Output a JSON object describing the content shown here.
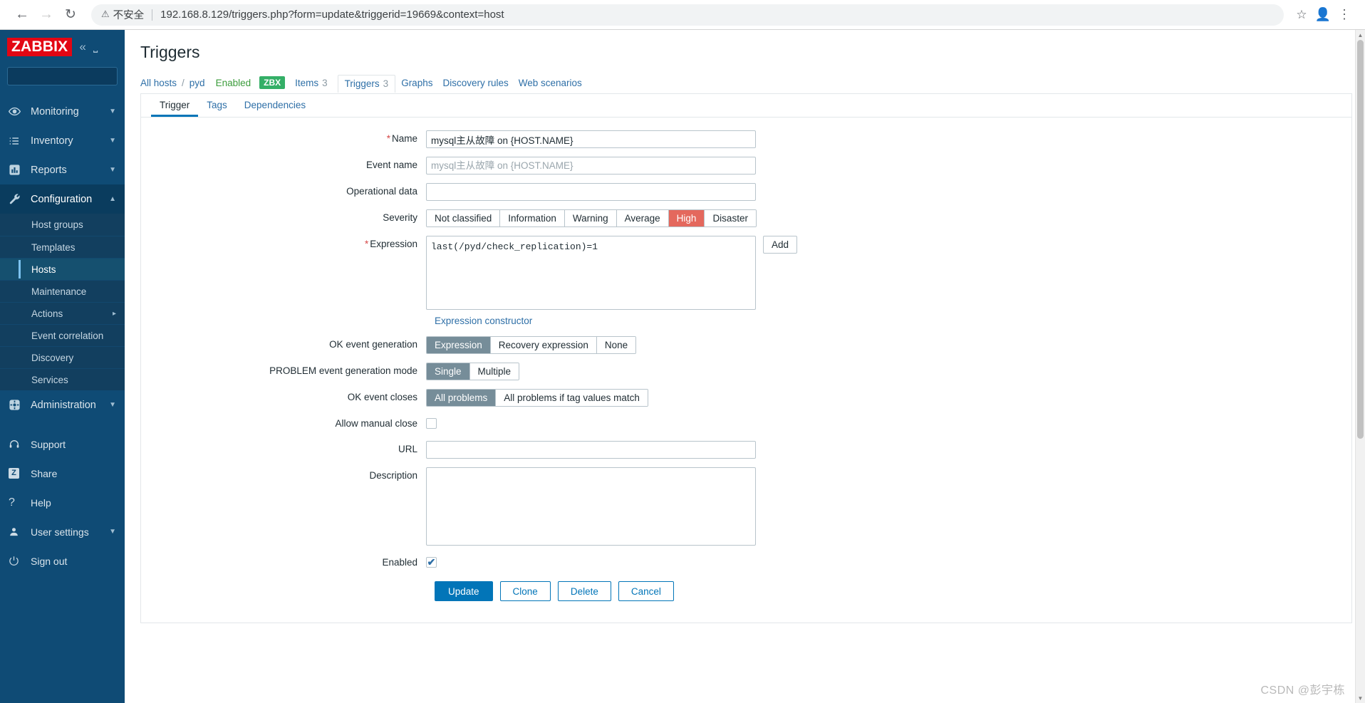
{
  "browser": {
    "back_icon": "back-arrow-icon",
    "forward_icon": "forward-arrow-icon",
    "reload_icon": "reload-icon",
    "warning_icon": "warning-triangle-icon",
    "security_label": "不安全",
    "url": "192.168.8.129/triggers.php?form=update&triggerid=19669&context=host",
    "star_icon": "bookmark-star-icon",
    "profile_icon": "profile-avatar-icon",
    "menu_icon": "kebab-menu-icon"
  },
  "sidebar": {
    "logo": "ZABBIX",
    "collapse_icon": "collapse-chevrons-icon",
    "hide_icon": "hide-sidebar-icon",
    "search": {
      "value": "",
      "placeholder": ""
    },
    "search_icon": "search-icon",
    "items": [
      {
        "label": "Monitoring",
        "icon": "eye-icon",
        "chevron": "⌄"
      },
      {
        "label": "Inventory",
        "icon": "list-icon",
        "chevron": "⌄"
      },
      {
        "label": "Reports",
        "icon": "bar-chart-icon",
        "chevron": "⌄"
      },
      {
        "label": "Configuration",
        "icon": "wrench-icon",
        "chevron": "⌃"
      }
    ],
    "submenu": [
      {
        "label": "Host groups"
      },
      {
        "label": "Templates"
      },
      {
        "label": "Hosts"
      },
      {
        "label": "Maintenance"
      },
      {
        "label": "Actions"
      },
      {
        "label": "Event correlation"
      },
      {
        "label": "Discovery"
      },
      {
        "label": "Services"
      }
    ],
    "administration": {
      "label": "Administration",
      "icon": "gear-icon",
      "chevron": "⌄"
    },
    "footer": [
      {
        "label": "Support",
        "icon": "headset-icon"
      },
      {
        "label": "Share",
        "icon": "zabbix-z-icon"
      },
      {
        "label": "Help",
        "icon": "question-mark-icon"
      },
      {
        "label": "User settings",
        "icon": "user-icon",
        "chevron": "⌄"
      },
      {
        "label": "Sign out",
        "icon": "power-icon"
      }
    ]
  },
  "header": {
    "title": "Triggers"
  },
  "breadcrumb": {
    "all_hosts": "All hosts",
    "separator": "/",
    "host": "pyd",
    "status": "Enabled",
    "agent_tag": "ZBX",
    "tabs": [
      {
        "label": "Items",
        "count": "3",
        "current": false
      },
      {
        "label": "Triggers",
        "count": "3",
        "current": true
      },
      {
        "label": "Graphs",
        "count": "",
        "current": false
      },
      {
        "label": "Discovery rules",
        "count": "",
        "current": false
      },
      {
        "label": "Web scenarios",
        "count": "",
        "current": false
      }
    ]
  },
  "form_tabs": [
    {
      "label": "Trigger",
      "active": true
    },
    {
      "label": "Tags",
      "active": false
    },
    {
      "label": "Dependencies",
      "active": false
    }
  ],
  "form": {
    "name": {
      "label": "Name",
      "required": true,
      "value": "mysql主从故障 on {HOST.NAME}",
      "placeholder": ""
    },
    "event_name": {
      "label": "Event name",
      "required": false,
      "value": "",
      "placeholder": "mysql主从故障 on {HOST.NAME}"
    },
    "operational_data": {
      "label": "Operational data",
      "required": false,
      "value": "",
      "placeholder": ""
    },
    "severity": {
      "label": "Severity",
      "options": [
        "Not classified",
        "Information",
        "Warning",
        "Average",
        "High",
        "Disaster"
      ],
      "selected": "High",
      "selected_color": "#e4685d"
    },
    "expression": {
      "label": "Expression",
      "required": true,
      "value": "last(/pyd/check_replication)=1",
      "add_button": "Add",
      "constructor_link": "Expression constructor"
    },
    "ok_event_generation": {
      "label": "OK event generation",
      "options": [
        "Expression",
        "Recovery expression",
        "None"
      ],
      "selected": "Expression"
    },
    "problem_event_generation_mode": {
      "label": "PROBLEM event generation mode",
      "options": [
        "Single",
        "Multiple"
      ],
      "selected": "Single"
    },
    "ok_event_closes": {
      "label": "OK event closes",
      "options": [
        "All problems",
        "All problems if tag values match"
      ],
      "selected": "All problems"
    },
    "allow_manual_close": {
      "label": "Allow manual close",
      "checked": false
    },
    "url": {
      "label": "URL",
      "value": "",
      "placeholder": ""
    },
    "description": {
      "label": "Description",
      "value": "",
      "placeholder": ""
    },
    "enabled": {
      "label": "Enabled",
      "checked": true,
      "check_glyph": "✔"
    },
    "buttons": {
      "update": "Update",
      "clone": "Clone",
      "delete": "Delete",
      "cancel": "Cancel"
    }
  },
  "watermark": "CSDN @彭宇栋",
  "colors": {
    "sidebar_bg": "#0f4b75",
    "accent": "#0275b8",
    "logo_red": "#e30613",
    "enabled_green": "#3b9c3b",
    "zbx_green": "#34af67",
    "high_severity": "#e4685d"
  }
}
